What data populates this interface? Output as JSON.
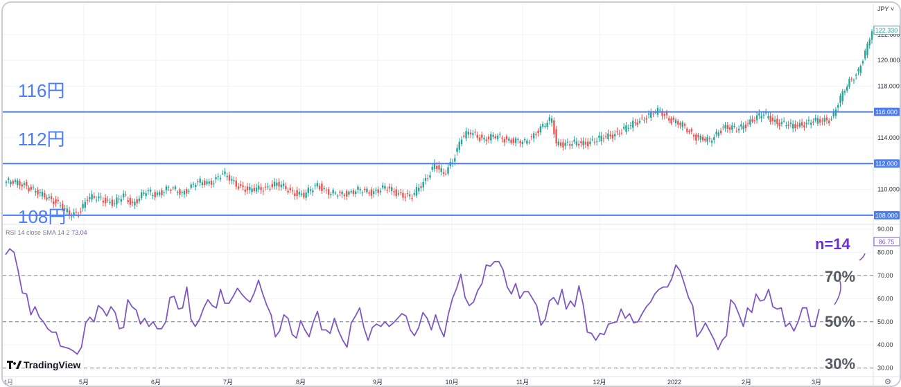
{
  "currency_menu": "JPY",
  "chart_data": [
    {
      "type": "candlestick",
      "title": "",
      "y_ticks": [
        "122.000",
        "120.000",
        "118.000",
        "116.000",
        "114.000",
        "112.000",
        "110.000",
        "108.000"
      ],
      "ylim": [
        107.4,
        123.6
      ],
      "last_price": "122.330",
      "x_ticks": [
        "5月",
        "6月",
        "7月",
        "8月",
        "9月",
        "10月",
        "11月",
        "12月",
        "2022",
        "2月",
        "3月"
      ],
      "first_x_label": "4月",
      "levels": [
        {
          "value": 116,
          "label": "116円",
          "axis_label": "116.000"
        },
        {
          "value": 112,
          "label": "112円",
          "axis_label": "112.000"
        },
        {
          "value": 108,
          "label": "108円",
          "axis_label": "108.000"
        }
      ],
      "colors": {
        "up": "#26a69a",
        "down": "#ef5350",
        "level": "#4c7cf3"
      },
      "close_anchors": [
        [
          0,
          110.6
        ],
        [
          8,
          110.4
        ],
        [
          15,
          109.6
        ],
        [
          22,
          109.1
        ],
        [
          28,
          108.0
        ],
        [
          32,
          108.2
        ],
        [
          36,
          109.3
        ],
        [
          42,
          109.3
        ],
        [
          48,
          108.9
        ],
        [
          52,
          109.5
        ],
        [
          56,
          108.9
        ],
        [
          62,
          109.8
        ],
        [
          66,
          109.6
        ],
        [
          72,
          110.1
        ],
        [
          78,
          109.7
        ],
        [
          84,
          110.5
        ],
        [
          90,
          110.5
        ],
        [
          96,
          111.2
        ],
        [
          102,
          110.4
        ],
        [
          108,
          109.9
        ],
        [
          114,
          110.1
        ],
        [
          120,
          110.4
        ],
        [
          126,
          109.9
        ],
        [
          132,
          109.5
        ],
        [
          138,
          110.4
        ],
        [
          144,
          109.6
        ],
        [
          150,
          109.7
        ],
        [
          156,
          109.9
        ],
        [
          162,
          109.8
        ],
        [
          168,
          110.1
        ],
        [
          174,
          109.7
        ],
        [
          180,
          109.4
        ],
        [
          186,
          110.8
        ],
        [
          190,
          111.9
        ],
        [
          194,
          111.1
        ],
        [
          198,
          112.3
        ],
        [
          202,
          114.0
        ],
        [
          206,
          114.4
        ],
        [
          212,
          113.9
        ],
        [
          218,
          114.1
        ],
        [
          224,
          113.8
        ],
        [
          230,
          113.6
        ],
        [
          236,
          114.6
        ],
        [
          242,
          115.4
        ],
        [
          244,
          113.6
        ],
        [
          250,
          113.5
        ],
        [
          256,
          113.6
        ],
        [
          262,
          113.8
        ],
        [
          268,
          114.2
        ],
        [
          274,
          114.6
        ],
        [
          280,
          115.3
        ],
        [
          286,
          115.8
        ],
        [
          290,
          116.1
        ],
        [
          294,
          115.5
        ],
        [
          300,
          114.9
        ],
        [
          306,
          114.1
        ],
        [
          312,
          113.7
        ],
        [
          318,
          114.9
        ],
        [
          324,
          114.6
        ],
        [
          330,
          115.3
        ],
        [
          336,
          115.8
        ],
        [
          342,
          115.2
        ],
        [
          348,
          114.9
        ],
        [
          354,
          115.1
        ],
        [
          360,
          115.3
        ],
        [
          366,
          115.5
        ],
        [
          370,
          117.0
        ],
        [
          374,
          118.4
        ],
        [
          378,
          119.2
        ],
        [
          382,
          121.0
        ],
        [
          384,
          122.3
        ]
      ]
    },
    {
      "type": "line",
      "title": "",
      "indicator": {
        "name": "RSI",
        "period": "14",
        "source": "close",
        "ma": "SMA",
        "ma_length": "14",
        "ma_offset": "2",
        "value": "73.04"
      },
      "last_value": "86.75",
      "y_ticks": [
        "90.00",
        "80.00",
        "70.00",
        "60.00",
        "50.00",
        "40.00",
        "30.00"
      ],
      "ylim": [
        27.5,
        91.5
      ],
      "guides": [
        70,
        50,
        30
      ],
      "annotations": {
        "period": "n=14",
        "upper": "70%",
        "middle": "50%",
        "lower": "30%"
      },
      "line_color": "#7e57c2",
      "values": [
        79.0,
        81.5,
        80.0,
        72.0,
        62.5,
        62.0,
        53.0,
        56.5,
        52.0,
        50.0,
        47.0,
        45.5,
        45.5,
        39.5,
        39.0,
        38.5,
        37.5,
        36.0,
        39.0,
        49.5,
        52.0,
        50.0,
        57.0,
        55.5,
        52.5,
        56.5,
        54.0,
        47.0,
        47.5,
        59.5,
        56.5,
        55.0,
        49.0,
        51.5,
        48.0,
        50.0,
        47.0,
        47.0,
        50.0,
        60.5,
        61.0,
        55.5,
        56.0,
        65.0,
        51.0,
        48.0,
        51.0,
        56.0,
        59.5,
        57.0,
        56.0,
        64.0,
        58.0,
        58.0,
        61.0,
        64.5,
        62.0,
        60.0,
        58.5,
        62.5,
        68.0,
        62.0,
        57.0,
        53.0,
        43.5,
        46.0,
        53.0,
        51.5,
        44.5,
        43.0,
        50.5,
        46.5,
        43.5,
        50.0,
        54.5,
        46.5,
        46.5,
        45.0,
        51.5,
        46.0,
        42.0,
        39.0,
        49.5,
        52.5,
        56.0,
        47.5,
        42.0,
        47.5,
        49.0,
        48.0,
        50.0,
        48.0,
        49.5,
        51.5,
        53.5,
        52.5,
        46.5,
        44.0,
        47.5,
        54.0,
        51.5,
        46.5,
        53.0,
        47.5,
        43.5,
        53.0,
        60.0,
        64.5,
        70.5,
        60.5,
        57.0,
        58.5,
        63.5,
        66.5,
        74.5,
        74.0,
        76.0,
        76.0,
        72.5,
        65.0,
        62.0,
        66.5,
        60.0,
        63.0,
        63.0,
        60.0,
        57.0,
        48.5,
        51.0,
        59.0,
        60.5,
        57.5,
        64.0,
        55.5,
        59.0,
        56.5,
        65.5,
        57.5,
        45.5,
        45.0,
        42.0,
        45.0,
        44.5,
        49.0,
        49.5,
        50.0,
        55.5,
        51.5,
        53.5,
        49.5,
        50.0,
        53.5,
        56.5,
        58.5,
        62.0,
        64.0,
        65.0,
        65.0,
        68.5,
        74.5,
        72.0,
        66.5,
        60.5,
        57.0,
        43.5,
        46.0,
        49.5,
        46.0,
        42.5,
        38.0,
        42.0,
        44.0,
        59.5,
        57.5,
        53.0,
        48.0,
        56.0,
        54.0,
        62.0,
        59.0,
        59.5,
        64.0,
        56.5,
        55.5,
        56.0,
        48.0,
        49.5,
        46.0,
        50.0,
        56.0,
        56.0,
        48.0,
        48.0,
        55.5
      ]
    }
  ]
}
